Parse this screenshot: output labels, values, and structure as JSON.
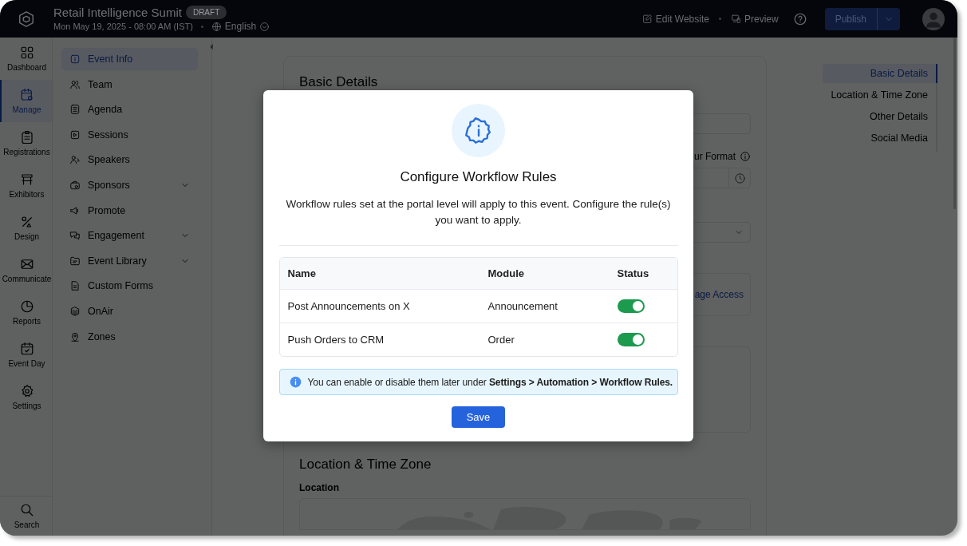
{
  "header": {
    "title": "Retail Intelligence Sumit",
    "badge": "DRAFT",
    "date": "Mon May 19, 2025 - 08:00 AM (IST)",
    "language": "English",
    "actions": [
      "Edit Website",
      "Preview"
    ],
    "publish": "Publish"
  },
  "rail": [
    {
      "label": "Dashboard",
      "selected": false
    },
    {
      "label": "Manage",
      "selected": true
    },
    {
      "label": "Registrations",
      "selected": false
    },
    {
      "label": "Exhibitors",
      "selected": false
    },
    {
      "label": "Design",
      "selected": false
    },
    {
      "label": "Communicate",
      "selected": false
    },
    {
      "label": "Reports",
      "selected": false
    },
    {
      "label": "Event Day",
      "selected": false
    },
    {
      "label": "Settings",
      "selected": false
    }
  ],
  "rail_bottom": {
    "label": "Search"
  },
  "nav": [
    {
      "label": "Event Info",
      "selected": true,
      "expandable": false
    },
    {
      "label": "Team",
      "selected": false,
      "expandable": false
    },
    {
      "label": "Agenda",
      "selected": false,
      "expandable": false
    },
    {
      "label": "Sessions",
      "selected": false,
      "expandable": false
    },
    {
      "label": "Speakers",
      "selected": false,
      "expandable": false
    },
    {
      "label": "Sponsors",
      "selected": false,
      "expandable": true
    },
    {
      "label": "Promote",
      "selected": false,
      "expandable": false
    },
    {
      "label": "Engagement",
      "selected": false,
      "expandable": true
    },
    {
      "label": "Event Library",
      "selected": false,
      "expandable": true
    },
    {
      "label": "Custom Forms",
      "selected": false,
      "expandable": false
    },
    {
      "label": "OnAir",
      "selected": false,
      "expandable": false
    },
    {
      "label": "Zones",
      "selected": false,
      "expandable": false
    }
  ],
  "content": {
    "heading": "Basic Details",
    "format_label": "ur Format",
    "access_link": "age Access",
    "section": "Location & Time Zone",
    "location_label": "Location"
  },
  "section_nav": [
    {
      "label": "Basic Details",
      "selected": true
    },
    {
      "label": "Location & Time Zone",
      "selected": false
    },
    {
      "label": "Other Details",
      "selected": false
    },
    {
      "label": "Social Media",
      "selected": false
    }
  ],
  "modal": {
    "title": "Configure Workflow Rules",
    "description": "Workflow rules set at the portal level will apply to this event. Configure the rule(s) you want to apply.",
    "table": {
      "columns": [
        "Name",
        "Module",
        "Status"
      ],
      "rows": [
        {
          "name": "Post Announcements on X",
          "module": "Announcement",
          "on": true
        },
        {
          "name": "Push Orders to CRM",
          "module": "Order",
          "on": true
        }
      ]
    },
    "note": "You can enable or disable them later under **Settings > Automation > Workflow Rules.**",
    "save": "Save"
  }
}
